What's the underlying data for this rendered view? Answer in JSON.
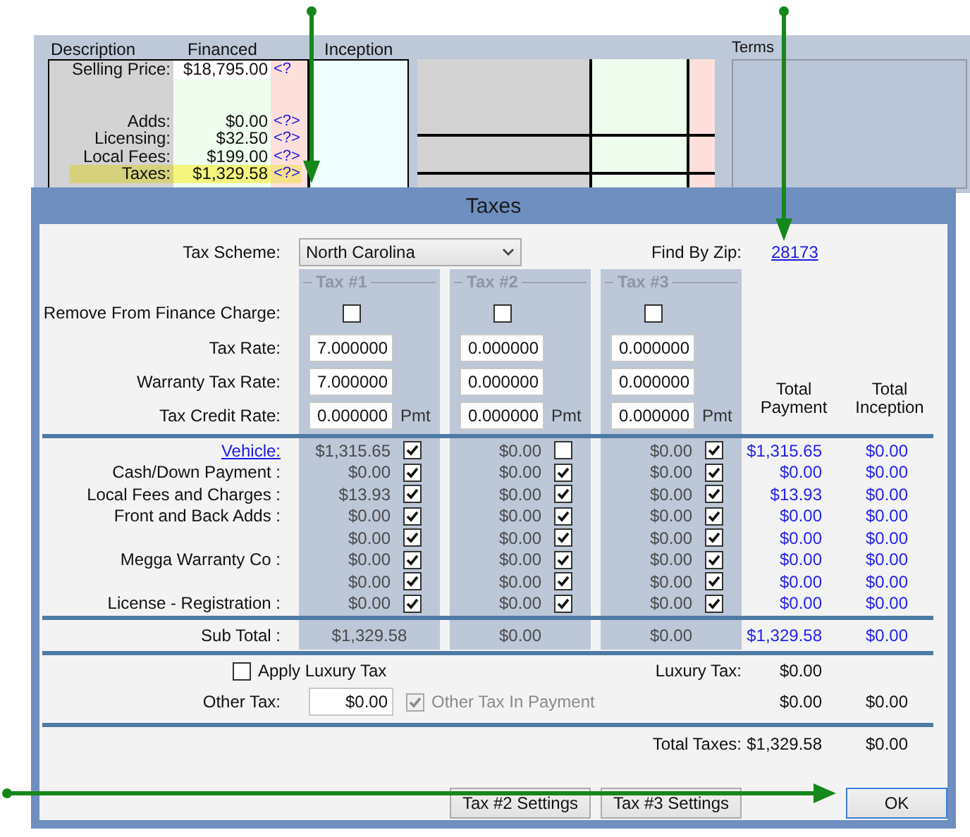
{
  "background_form": {
    "headers": [
      "Description",
      "Financed",
      "Inception"
    ],
    "rows": [
      {
        "label": "Selling Price:",
        "financed": "$18,795.00",
        "marker": "<?",
        "highlighted": false
      },
      {
        "label": "Adds:",
        "financed": "$0.00",
        "marker": "<?>",
        "highlighted": false
      },
      {
        "label": "Licensing:",
        "financed": "$32.50",
        "marker": "<?>",
        "highlighted": false
      },
      {
        "label": "Local Fees:",
        "financed": "$199.00",
        "marker": "<?>",
        "highlighted": false
      },
      {
        "label": "Taxes:",
        "financed": "$1,329.58",
        "marker": "<?>",
        "highlighted": true
      }
    ],
    "terms_label": "Terms"
  },
  "dialog": {
    "title": "Taxes",
    "tax_scheme": {
      "label": "Tax Scheme:",
      "value": "North Carolina"
    },
    "find_by_zip": {
      "label": "Find By Zip:",
      "value": "28173"
    },
    "field_labels": [
      "Remove From Finance Charge:",
      "Tax Rate:",
      "Warranty Tax Rate:",
      "Tax Credit Rate:"
    ],
    "taxes": [
      {
        "title": "Tax #1",
        "remove_from_finance_charge": false,
        "tax_rate": "7.000000",
        "warranty_tax_rate": "7.000000",
        "tax_credit_rate": "0.000000",
        "credit_unit": "Pmt"
      },
      {
        "title": "Tax #2",
        "remove_from_finance_charge": false,
        "tax_rate": "0.000000",
        "warranty_tax_rate": "0.000000",
        "tax_credit_rate": "0.000000",
        "credit_unit": "Pmt"
      },
      {
        "title": "Tax #3",
        "remove_from_finance_charge": false,
        "tax_rate": "0.000000",
        "warranty_tax_rate": "0.000000",
        "tax_credit_rate": "0.000000",
        "credit_unit": "Pmt"
      }
    ],
    "total_headers": [
      "Total Payment",
      "Total Inception"
    ],
    "rows": [
      {
        "kind": "link",
        "label": "Vehicle:",
        "amounts": [
          {
            "value": "$1,315.65",
            "checked": true
          },
          {
            "value": "$0.00",
            "checked": false
          },
          {
            "value": "$0.00",
            "checked": true
          }
        ],
        "total_payment": "$1,315.65",
        "total_inception": "$0.00"
      },
      {
        "kind": "text",
        "label": "Cash/Down Payment :",
        "amounts": [
          {
            "value": "$0.00",
            "checked": true
          },
          {
            "value": "$0.00",
            "checked": true
          },
          {
            "value": "$0.00",
            "checked": true
          }
        ],
        "total_payment": "$0.00",
        "total_inception": "$0.00"
      },
      {
        "kind": "text",
        "label": "Local Fees and Charges :",
        "amounts": [
          {
            "value": "$13.93",
            "checked": true
          },
          {
            "value": "$0.00",
            "checked": true
          },
          {
            "value": "$0.00",
            "checked": true
          }
        ],
        "total_payment": "$13.93",
        "total_inception": "$0.00"
      },
      {
        "kind": "text",
        "label": "Front and Back Adds :",
        "amounts": [
          {
            "value": "$0.00",
            "checked": true
          },
          {
            "value": "$0.00",
            "checked": true
          },
          {
            "value": "$0.00",
            "checked": true
          }
        ],
        "total_payment": "$0.00",
        "total_inception": "$0.00"
      },
      {
        "kind": "blank",
        "amounts": [
          {
            "value": "$0.00",
            "checked": true
          },
          {
            "value": "$0.00",
            "checked": true
          },
          {
            "value": "$0.00",
            "checked": true
          }
        ],
        "total_payment": "$0.00",
        "total_inception": "$0.00"
      },
      {
        "kind": "text",
        "label": "Megga Warranty Co :",
        "amounts": [
          {
            "value": "$0.00",
            "checked": true
          },
          {
            "value": "$0.00",
            "checked": true
          },
          {
            "value": "$0.00",
            "checked": true
          }
        ],
        "total_payment": "$0.00",
        "total_inception": "$0.00"
      },
      {
        "kind": "blank",
        "amounts": [
          {
            "value": "$0.00",
            "checked": true
          },
          {
            "value": "$0.00",
            "checked": true
          },
          {
            "value": "$0.00",
            "checked": true
          }
        ],
        "total_payment": "$0.00",
        "total_inception": "$0.00"
      },
      {
        "kind": "text",
        "label": "License - Registration :",
        "amounts": [
          {
            "value": "$0.00",
            "checked": true
          },
          {
            "value": "$0.00",
            "checked": true
          },
          {
            "value": "$0.00",
            "checked": true
          }
        ],
        "total_payment": "$0.00",
        "total_inception": "$0.00"
      }
    ],
    "sub_total": {
      "label": "Sub Total :",
      "values": [
        "$1,329.58",
        "$0.00",
        "$0.00"
      ],
      "total_payment": "$1,329.58",
      "total_inception": "$0.00"
    },
    "luxury": {
      "checkbox_label": "Apply Luxury Tax",
      "checked": false,
      "label": "Luxury Tax:",
      "value": "$0.00"
    },
    "other_tax": {
      "label": "Other Tax:",
      "value": "$0.00",
      "in_payment_label": "Other Tax In Payment",
      "in_payment": true,
      "disabled": true,
      "total_payment": "$0.00",
      "total_inception": "$0.00"
    },
    "total_taxes": {
      "label": "Total Taxes:",
      "total_payment": "$1,329.58",
      "total_inception": "$0.00"
    },
    "buttons": [
      {
        "label": "Tax #2 Settings",
        "default": false
      },
      {
        "label": "Tax #3 Settings",
        "default": false
      },
      {
        "label": "OK",
        "default": true
      }
    ]
  }
}
